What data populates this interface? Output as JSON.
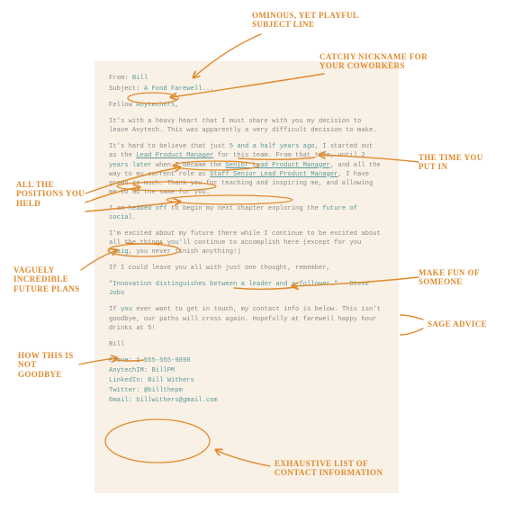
{
  "email": {
    "from_label": "From:",
    "from_value": "Bill",
    "subject_label": "Subject:",
    "subject_value": "A Fond Farewell...",
    "greeting_prefix": "Fellow ",
    "greeting_nick": "Anytechers",
    "greeting_suffix": ",",
    "p1": "It's with a heavy heart that I must share with you my decision to leave Anytech. This was apparently a very difficult decision to make.",
    "p2_a": "It's hard to believe that just ",
    "p2_time": "5 and a half years ago",
    "p2_b": ", I started out as the ",
    "p2_pos1": "Lead Product Manager",
    "p2_c": " for this team. From that time, until ",
    "p2_time2": "2 years later",
    "p2_d": " when I became the ",
    "p2_pos2": "Senior Lead Product Manager",
    "p2_e": ", and all the way to my current role as ",
    "p2_pos3": "Staff Senior Lead Product Manager",
    "p2_f": ", I have grown so much. Thank you for teaching and inspiring me, and allowing me to do the same for you.",
    "p3_a": "I am ",
    "p3_head": "headed off",
    "p3_b": " to begin my next chapter exploring the ",
    "p3_future": "future of social",
    "p3_c": ".",
    "p4_a": "I'm excited about my future there while I continue to be excited about all the things you'll continue to accomplish here (except for you ",
    "p4_name": "Craig",
    "p4_b": ", you never finish anything!)",
    "p5": "If I could leave you all with just one thought, remember,",
    "quote": "\"Innovation distinguishes between a leader and a follower.\" - Steve Jobs",
    "p6_a": "If ",
    "p6_you": "you",
    "p6_b": " ever want to get in touch, my contact info is below. This isn't goodbye, our paths will cross again. Hopefully at farewell happy hour drinks at 5!",
    "signoff": "Bill",
    "contact": {
      "phone": "Phone: 1-555-555-9898",
      "im": "AnytechIM: BillPM",
      "linkedin": "LinkedIn: Bill Withers",
      "twitter": "Twitter: @billthepm",
      "gmail": "Gmail: billwithers@gmail.com"
    }
  },
  "annotations": {
    "subject": "OMINOUS, YET PLAYFUL SUBJECT LINE",
    "nickname": "CATCHY NICKNAME FOR YOUR COWORKERS",
    "time": "THE TIME YOU PUT IN",
    "positions": "ALL THE POSITIONS YOU HELD",
    "future": "VAGUELY INCREDIBLE FUTURE PLANS",
    "makefun": "MAKE FUN OF SOMEONE",
    "sage": "SAGE ADVICE",
    "notgoodbye": "HOW THIS IS NOT GOODBYE",
    "contacts": "EXHAUSTIVE LIST OF CONTACT INFORMATION"
  }
}
